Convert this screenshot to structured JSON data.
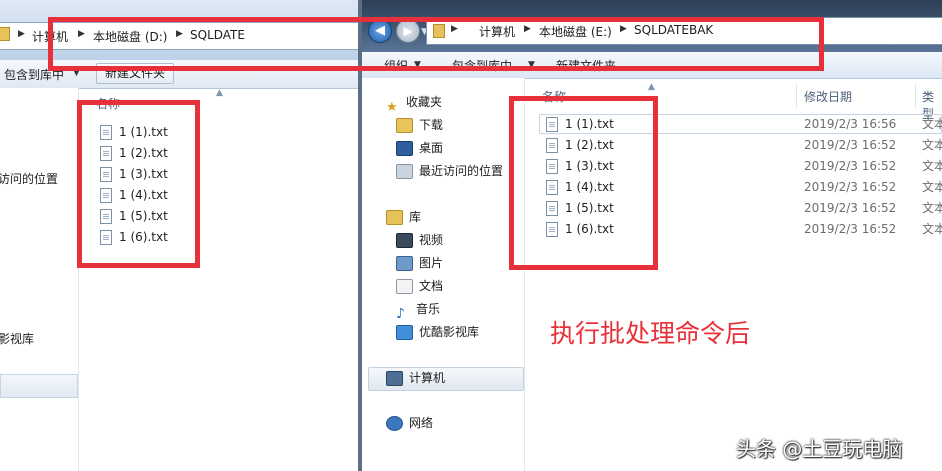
{
  "left_window": {
    "breadcrumbs": [
      "计算机",
      "本地磁盘 (D:)",
      "SQLDATE"
    ],
    "toolbar": {
      "include_label": "包含到库中",
      "new_folder_label": "新建文件夹"
    },
    "column_name": "名称",
    "nav_items": [
      "访问的位置",
      "影视库"
    ],
    "files": [
      "1 (1).txt",
      "1 (2).txt",
      "1 (3).txt",
      "1 (4).txt",
      "1 (5).txt",
      "1 (6).txt"
    ]
  },
  "right_window": {
    "breadcrumbs": [
      "计算机",
      "本地磁盘 (E:)",
      "SQLDATEBAK"
    ],
    "toolbar": {
      "organize_label": "组织",
      "include_label": "包含到库中",
      "new_folder_label": "新建文件夹"
    },
    "columns": {
      "name": "名称",
      "modified": "修改日期",
      "type": "类型"
    },
    "favorites": {
      "title": "收藏夹",
      "items": [
        "下载",
        "桌面",
        "最近访问的位置"
      ]
    },
    "libraries": {
      "title": "库",
      "items": [
        "视频",
        "图片",
        "文档",
        "音乐",
        "优酷影视库"
      ]
    },
    "computer": "计算机",
    "network": "网络",
    "files": [
      {
        "name": "1 (1).txt",
        "modified": "2019/2/3 16:56",
        "type": "文本"
      },
      {
        "name": "1 (2).txt",
        "modified": "2019/2/3 16:52",
        "type": "文本"
      },
      {
        "name": "1 (3).txt",
        "modified": "2019/2/3 16:52",
        "type": "文本"
      },
      {
        "name": "1 (4).txt",
        "modified": "2019/2/3 16:52",
        "type": "文本"
      },
      {
        "name": "1 (5).txt",
        "modified": "2019/2/3 16:52",
        "type": "文本"
      },
      {
        "name": "1 (6).txt",
        "modified": "2019/2/3 16:52",
        "type": "文本"
      }
    ]
  },
  "annotation": "执行批处理命令后",
  "watermark": "头条 @土豆玩电脑",
  "colors": {
    "annotation_red": "#e8303a",
    "highlight_box": "#e8303a"
  }
}
